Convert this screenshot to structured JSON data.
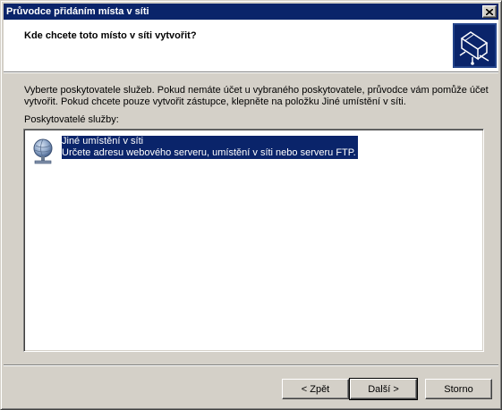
{
  "window": {
    "title": "Průvodce přidáním místa v síti",
    "close_glyph": "close-icon"
  },
  "header": {
    "title": "Kde chcete toto místo v síti vytvořit?",
    "icon": "network-folder-wizard-icon"
  },
  "body": {
    "description": "Vyberte poskytovatele služeb.  Pokud nemáte účet u vybraného poskytovatele, průvodce vám pomůže účet\nvytvořit.  Pokud chcete pouze vytvořit zástupce, klepněte na položku Jiné umístění v síti.",
    "list_label": "Poskytovatelé služby:"
  },
  "providers": [
    {
      "name": "Jiné umístění v síti",
      "description": "Určete adresu webového serveru, umístění v síti nebo serveru FTP.",
      "icon": "network-location-icon",
      "selected": true
    }
  ],
  "buttons": {
    "back": "< Zpět",
    "next": "Další >",
    "cancel": "Storno"
  },
  "colors": {
    "titlebar": "#0a246a",
    "selection": "#0a246a",
    "face": "#d4d0c8"
  }
}
